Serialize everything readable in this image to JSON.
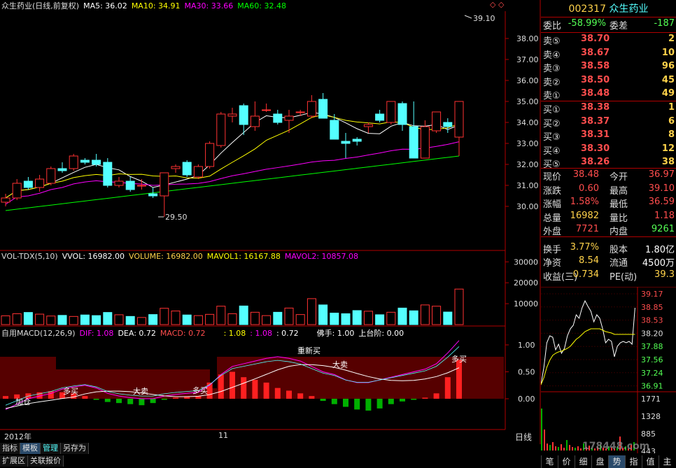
{
  "kline_header": {
    "title": "众生药业(日线,前复权)",
    "ma5": "MA5: 36.02",
    "ma10": "MA10: 34.91",
    "ma30": "MA30: 33.66",
    "ma60": "MA60: 32.48"
  },
  "vol_header": {
    "name": "VOL-TDX(5,10)",
    "vvol": "VVOL: 16982.00",
    "volume": "VOLUME: 16982.00",
    "mavol1": "MAVOL1: 16167.88",
    "mavol2": "MAVOL2: 10857.08"
  },
  "macd_header": {
    "name": "自用MACD(12,26,9)",
    "dif": "DIF: 1.08",
    "dea": "DEA: 0.72",
    "macd": "MACD: 0.72",
    "v1": ": 1.08",
    "v2": ": 1.08",
    "v3": ": 0.72",
    "foshou": "佛手: 1.00",
    "shangtai": "上台阶: 0.00"
  },
  "colors": {
    "up": "#ff3232",
    "down": "#54ffff",
    "ma5": "#ffffff",
    "ma10": "#ffff00",
    "ma30": "#ff00ff",
    "ma60": "#00ff00",
    "axis": "#b00000"
  },
  "price_axis": [
    "38.00",
    "37.00",
    "36.00",
    "35.00",
    "34.00",
    "33.00",
    "32.00",
    "31.00",
    "30.00"
  ],
  "vol_axis": [
    "30000",
    "20000",
    "10000"
  ],
  "macd_axis": [
    "1.00",
    "0.50",
    "0.00"
  ],
  "price_high_label": "39.10",
  "price_low_label": "29.50",
  "macd_annotations": [
    "加仓",
    "多买",
    "大卖",
    "多买",
    "重新买",
    "大卖",
    "多买"
  ],
  "x_axis": {
    "year": "2012年",
    "month": "11",
    "period": "日线"
  },
  "bottom_tabs": [
    "指标",
    "模板",
    "管理",
    "另存为"
  ],
  "status_tabs": [
    "扩展区",
    "关联报价"
  ],
  "right_tabs": [
    "笔",
    "价",
    "细",
    "盘",
    "势",
    "指",
    "值",
    "主"
  ],
  "quote": {
    "code": "002317",
    "name": "众生药业",
    "weibi_label": "委比",
    "weibi": "-58.99%",
    "weicha_label": "委差",
    "weicha": "-187",
    "asks": [
      {
        "label": "卖⑤",
        "price": "38.70",
        "qty": "2"
      },
      {
        "label": "卖④",
        "price": "38.67",
        "qty": "10"
      },
      {
        "label": "卖③",
        "price": "38.58",
        "qty": "96"
      },
      {
        "label": "卖②",
        "price": "38.50",
        "qty": "45"
      },
      {
        "label": "卖①",
        "price": "38.48",
        "qty": "49"
      }
    ],
    "bids": [
      {
        "label": "买①",
        "price": "38.38",
        "qty": "1"
      },
      {
        "label": "买②",
        "price": "38.37",
        "qty": "6"
      },
      {
        "label": "买③",
        "price": "38.31",
        "qty": "8"
      },
      {
        "label": "买④",
        "price": "38.30",
        "qty": "12"
      },
      {
        "label": "买⑤",
        "price": "38.26",
        "qty": "38"
      }
    ],
    "stats": [
      {
        "k": "现价",
        "v": "38.48",
        "vc": "#ff4d4d",
        "k2": "今开",
        "v2": "36.97",
        "v2c": "#ff4d4d"
      },
      {
        "k": "涨跌",
        "v": "0.60",
        "vc": "#ff4d4d",
        "k2": "最高",
        "v2": "39.10",
        "v2c": "#ff4d4d"
      },
      {
        "k": "涨幅",
        "v": "1.58%",
        "vc": "#ff4d4d",
        "k2": "最低",
        "v2": "36.59",
        "v2c": "#ff4d4d"
      },
      {
        "k": "总量",
        "v": "16982",
        "vc": "#ffd24a",
        "k2": "量比",
        "v2": "1.18",
        "v2c": "#ff4d4d"
      },
      {
        "k": "外盘",
        "v": "7721",
        "vc": "#ff4d4d",
        "k2": "内盘",
        "v2": "9261",
        "v2c": "#54ff54"
      },
      {
        "k": "换手",
        "v": "3.77%",
        "vc": "#ffd24a",
        "k2": "股本",
        "v2": "1.80亿",
        "v2c": "#ffffff"
      },
      {
        "k": "净资",
        "v": "8.54",
        "vc": "#ffd24a",
        "k2": "流通",
        "v2": "4500万",
        "v2c": "#ffffff"
      },
      {
        "k": "收益(三)",
        "v": "0.734",
        "vc": "#ffd24a",
        "k2": "PE(动)",
        "v2": "39.3",
        "v2c": "#ffd24a"
      }
    ]
  },
  "minute_axis": [
    "39.17",
    "38.85",
    "38.53",
    "38.20",
    "37.88",
    "37.56",
    "37.24",
    "36.91"
  ],
  "minute_vol_axis": [
    "1771",
    "1328",
    "885",
    "443"
  ],
  "watermark": "178448.com",
  "chart_data": {
    "type": "candlestick",
    "x": [
      1,
      2,
      3,
      4,
      5,
      6,
      7,
      8,
      9,
      10,
      11,
      12,
      13,
      14,
      15,
      16,
      17,
      18,
      19,
      20,
      21,
      22,
      23,
      24,
      25,
      26,
      27,
      28,
      29,
      30,
      31,
      32,
      33,
      34,
      35,
      36,
      37,
      38,
      39,
      40,
      41
    ],
    "ohlc": [
      [
        30.2,
        30.6,
        30.0,
        30.4
      ],
      [
        30.4,
        31.3,
        30.3,
        31.1
      ],
      [
        31.2,
        31.4,
        30.8,
        30.9
      ],
      [
        30.9,
        31.5,
        30.7,
        31.3
      ],
      [
        31.1,
        31.9,
        31.0,
        31.8
      ],
      [
        31.8,
        32.1,
        31.6,
        31.7
      ],
      [
        31.8,
        32.5,
        31.7,
        32.4
      ],
      [
        32.2,
        32.3,
        32.0,
        32.1
      ],
      [
        32.2,
        32.5,
        31.9,
        32.0
      ],
      [
        32.1,
        32.3,
        30.9,
        31.0
      ],
      [
        31.0,
        31.4,
        30.9,
        31.2
      ],
      [
        31.2,
        31.4,
        30.7,
        30.8
      ],
      [
        31.0,
        31.3,
        30.8,
        31.0
      ],
      [
        30.6,
        30.9,
        30.4,
        30.5
      ],
      [
        30.5,
        31.6,
        29.5,
        31.6
      ],
      [
        31.8,
        32.0,
        31.6,
        31.9
      ],
      [
        32.1,
        32.2,
        31.4,
        31.5
      ],
      [
        31.4,
        32.0,
        31.3,
        31.9
      ],
      [
        31.9,
        33.1,
        31.8,
        33.0
      ],
      [
        32.9,
        34.5,
        32.8,
        34.4
      ],
      [
        34.3,
        34.7,
        34.0,
        34.4
      ],
      [
        34.8,
        34.9,
        33.4,
        33.9
      ],
      [
        33.8,
        35.0,
        33.6,
        34.3
      ],
      [
        34.6,
        34.9,
        34.5,
        34.6
      ],
      [
        34.4,
        34.6,
        33.9,
        34.0
      ],
      [
        34.1,
        34.6,
        33.5,
        34.3
      ],
      [
        34.5,
        34.6,
        34.3,
        34.5
      ],
      [
        34.3,
        35.3,
        34.2,
        35.0
      ],
      [
        35.1,
        35.4,
        34.8,
        34.2
      ],
      [
        34.1,
        34.4,
        33.2,
        33.2
      ],
      [
        33.1,
        33.5,
        32.3,
        33.0
      ],
      [
        33.2,
        33.3,
        32.9,
        33.1
      ],
      [
        33.8,
        34.0,
        33.5,
        33.9
      ],
      [
        34.4,
        34.6,
        34.0,
        34.1
      ],
      [
        34.0,
        35.0,
        33.9,
        35.0
      ],
      [
        34.9,
        35.0,
        33.6,
        33.9
      ],
      [
        33.8,
        35.0,
        32.3,
        32.3
      ],
      [
        32.3,
        34.1,
        32.3,
        33.8
      ],
      [
        33.6,
        34.5,
        33.5,
        34.5
      ],
      [
        34.0,
        34.2,
        33.5,
        33.8
      ],
      [
        33.3,
        35.0,
        32.4,
        35.0
      ]
    ],
    "note": ""
  }
}
